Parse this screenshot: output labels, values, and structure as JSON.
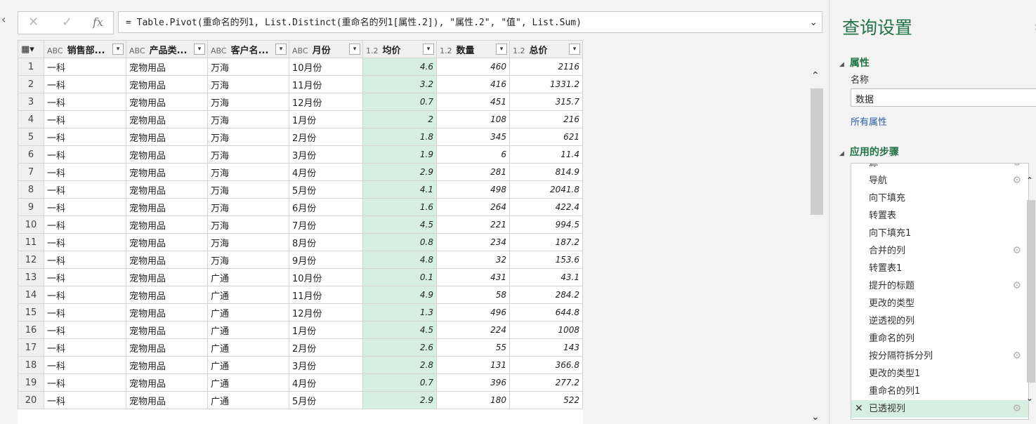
{
  "formula": {
    "cancel_icon": "x-icon",
    "confirm_icon": "check-icon",
    "fx_label": "fx",
    "text": "= Table.Pivot(重命名的列1, List.Distinct(重命名的列1[属性.2]), \"属性.2\", \"值\", List.Sum)"
  },
  "columns": [
    {
      "type": "ABC",
      "label": "销售部..."
    },
    {
      "type": "ABC",
      "label": "产品类..."
    },
    {
      "type": "ABC",
      "label": "客户名..."
    },
    {
      "type": "ABC",
      "label": "月份"
    },
    {
      "type": "1.2",
      "label": "均价"
    },
    {
      "type": "1.2",
      "label": "数量"
    },
    {
      "type": "1.2",
      "label": "总价"
    }
  ],
  "rows": [
    [
      "1",
      "一科",
      "宠物用品",
      "万海",
      "10月份",
      "4.6",
      "460",
      "2116"
    ],
    [
      "2",
      "一科",
      "宠物用品",
      "万海",
      "11月份",
      "3.2",
      "416",
      "1331.2"
    ],
    [
      "3",
      "一科",
      "宠物用品",
      "万海",
      "12月份",
      "0.7",
      "451",
      "315.7"
    ],
    [
      "4",
      "一科",
      "宠物用品",
      "万海",
      "1月份",
      "2",
      "108",
      "216"
    ],
    [
      "5",
      "一科",
      "宠物用品",
      "万海",
      "2月份",
      "1.8",
      "345",
      "621"
    ],
    [
      "6",
      "一科",
      "宠物用品",
      "万海",
      "3月份",
      "1.9",
      "6",
      "11.4"
    ],
    [
      "7",
      "一科",
      "宠物用品",
      "万海",
      "4月份",
      "2.9",
      "281",
      "814.9"
    ],
    [
      "8",
      "一科",
      "宠物用品",
      "万海",
      "5月份",
      "4.1",
      "498",
      "2041.8"
    ],
    [
      "9",
      "一科",
      "宠物用品",
      "万海",
      "6月份",
      "1.6",
      "264",
      "422.4"
    ],
    [
      "10",
      "一科",
      "宠物用品",
      "万海",
      "7月份",
      "4.5",
      "221",
      "994.5"
    ],
    [
      "11",
      "一科",
      "宠物用品",
      "万海",
      "8月份",
      "0.8",
      "234",
      "187.2"
    ],
    [
      "12",
      "一科",
      "宠物用品",
      "万海",
      "9月份",
      "4.8",
      "32",
      "153.6"
    ],
    [
      "13",
      "一科",
      "宠物用品",
      "广通",
      "10月份",
      "0.1",
      "431",
      "43.1"
    ],
    [
      "14",
      "一科",
      "宠物用品",
      "广通",
      "11月份",
      "4.9",
      "58",
      "284.2"
    ],
    [
      "15",
      "一科",
      "宠物用品",
      "广通",
      "12月份",
      "1.3",
      "496",
      "644.8"
    ],
    [
      "16",
      "一科",
      "宠物用品",
      "广通",
      "1月份",
      "4.5",
      "224",
      "1008"
    ],
    [
      "17",
      "一科",
      "宠物用品",
      "广通",
      "2月份",
      "2.6",
      "55",
      "143"
    ],
    [
      "18",
      "一科",
      "宠物用品",
      "广通",
      "3月份",
      "2.8",
      "131",
      "366.8"
    ],
    [
      "19",
      "一科",
      "宠物用品",
      "广通",
      "4月份",
      "0.7",
      "396",
      "277.2"
    ],
    [
      "20",
      "一科",
      "宠物用品",
      "广通",
      "5月份",
      "2.9",
      "180",
      "522"
    ]
  ],
  "panel": {
    "title": "查询设置",
    "props_heading": "属性",
    "name_label": "名称",
    "name_value": "数据",
    "all_props": "所有属性",
    "steps_heading": "应用的步骤",
    "steps": [
      {
        "label": "源",
        "gear": true
      },
      {
        "label": "导航",
        "gear": true
      },
      {
        "label": "向下填充",
        "gear": false
      },
      {
        "label": "转置表",
        "gear": false
      },
      {
        "label": "向下填充1",
        "gear": false
      },
      {
        "label": "合并的列",
        "gear": true
      },
      {
        "label": "转置表1",
        "gear": false
      },
      {
        "label": "提升的标题",
        "gear": true
      },
      {
        "label": "更改的类型",
        "gear": false
      },
      {
        "label": "逆透视的列",
        "gear": false
      },
      {
        "label": "重命名的列",
        "gear": false
      },
      {
        "label": "按分隔符拆分列",
        "gear": true
      },
      {
        "label": "更改的类型1",
        "gear": false
      },
      {
        "label": "重命名的列1",
        "gear": false
      },
      {
        "label": "已透视列",
        "gear": true,
        "active": true
      }
    ]
  },
  "colors": {
    "accent": "#217346",
    "selected_col": "#d6efe2",
    "link": "#2a5ca8"
  }
}
